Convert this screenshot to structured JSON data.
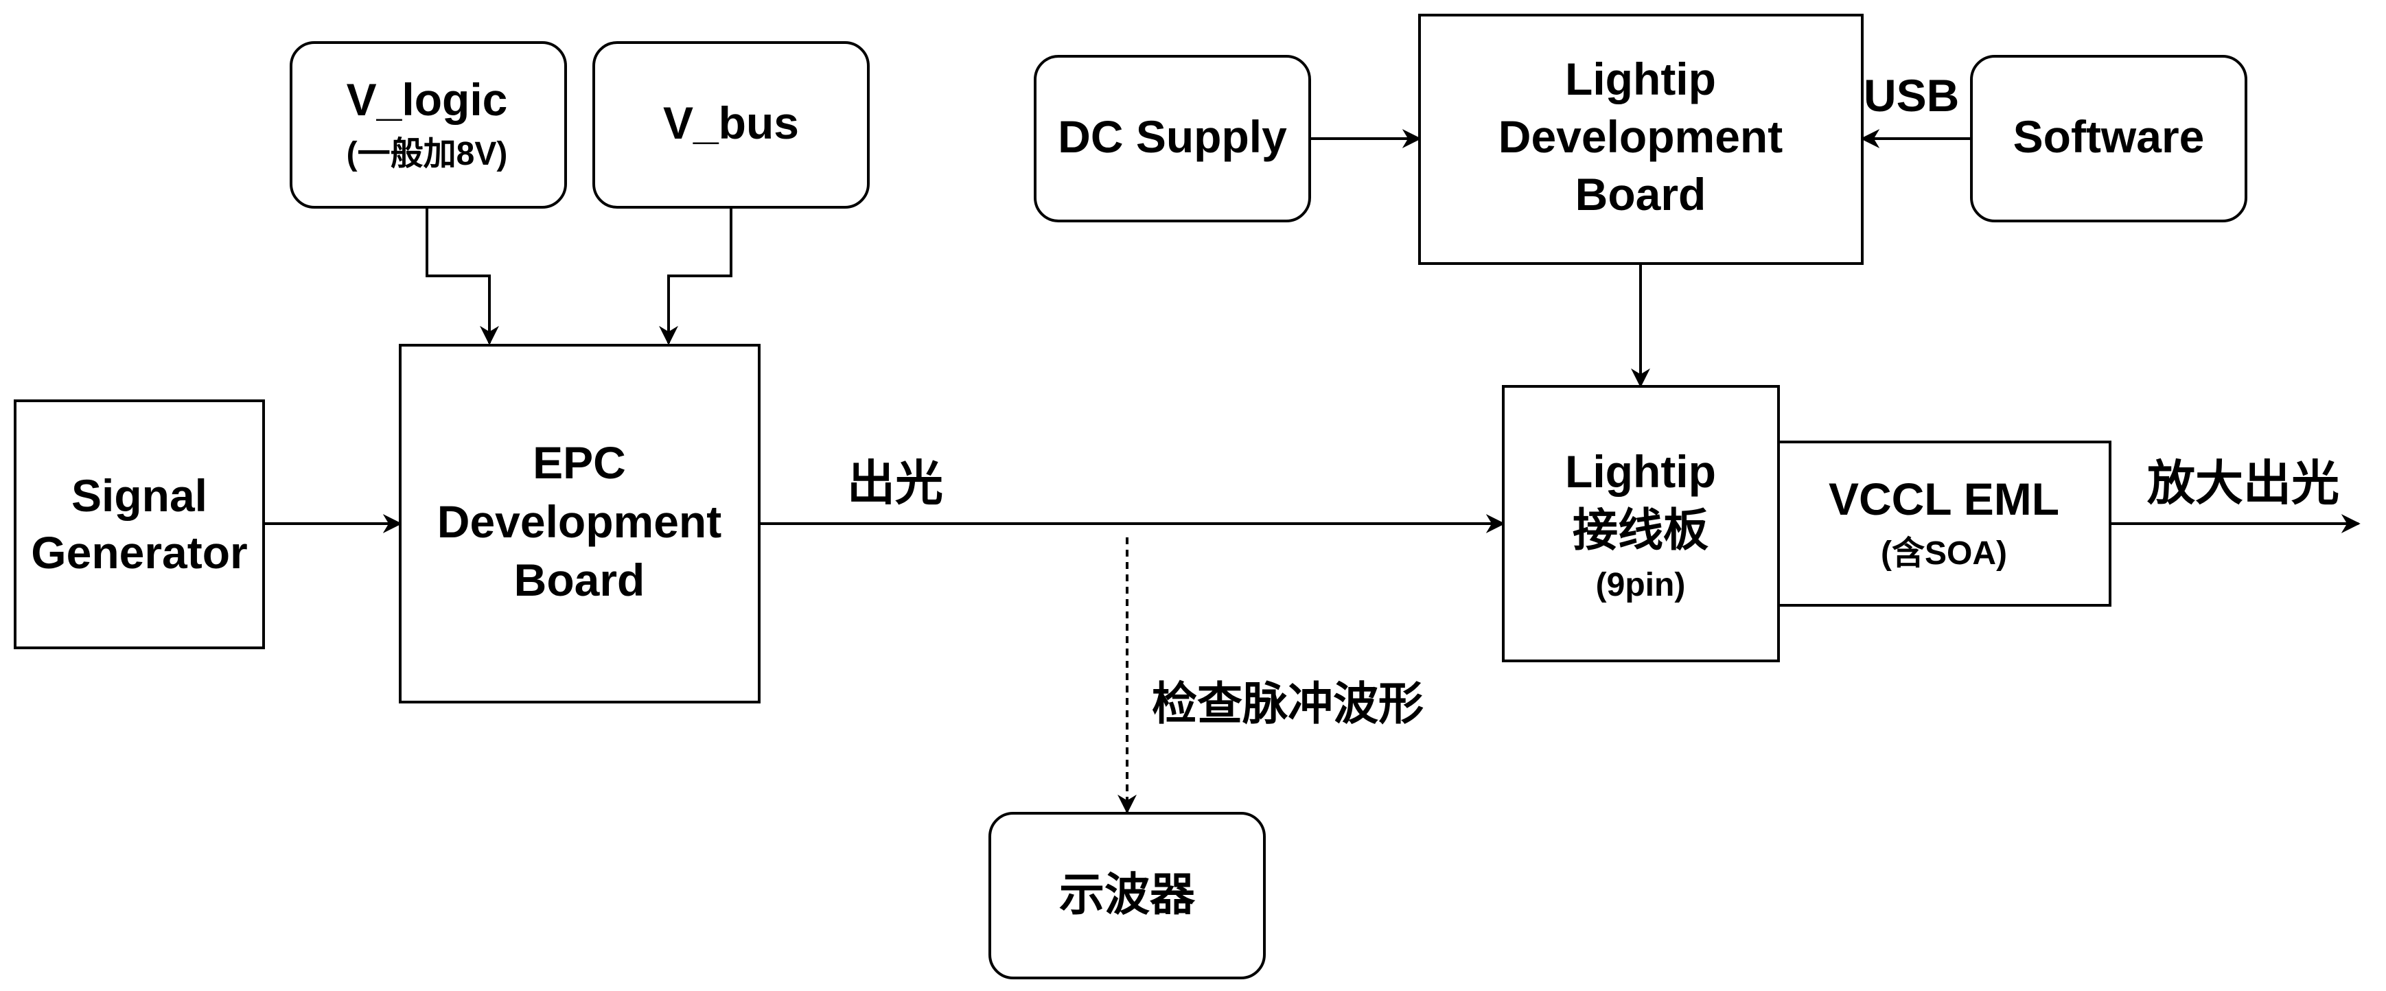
{
  "nodes": {
    "v_logic": {
      "line1": "V_logic",
      "line2": "(一般加8V)"
    },
    "v_bus": {
      "label": "V_bus"
    },
    "signal_generator": {
      "line1": "Signal",
      "line2": "Generator"
    },
    "epc_board": {
      "line1": "EPC",
      "line2": "Development",
      "line3": "Board"
    },
    "dc_supply": {
      "label": "DC Supply"
    },
    "lightip_dev_board": {
      "line1": "Lightip",
      "line2": "Development",
      "line3": "Board"
    },
    "software": {
      "label": "Software"
    },
    "lightip_adapter": {
      "line1": "Lightip",
      "line2": "接线板",
      "line3": "(9pin)"
    },
    "vccl_eml": {
      "line1": "VCCL EML",
      "line2": "(含SOA)"
    },
    "oscilloscope": {
      "label": "示波器"
    }
  },
  "edge_labels": {
    "light_out": "出光",
    "usb": "USB",
    "amplified_light_out": "放大出光",
    "check_pulse": "检查脉冲波形"
  },
  "colors": {
    "stroke": "#000000",
    "fill": "#ffffff"
  }
}
